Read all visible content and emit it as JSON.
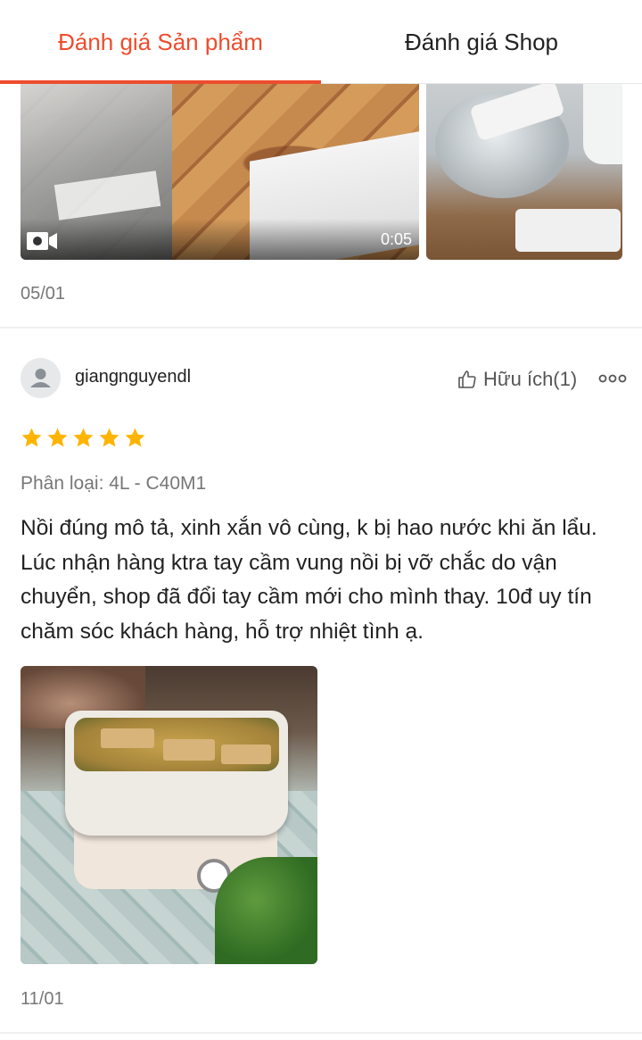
{
  "tabs": {
    "product_reviews": "Đánh giá Sản phẩm",
    "shop_reviews": "Đánh giá Shop"
  },
  "previous_review": {
    "video_duration": "0:05",
    "date": "05/01"
  },
  "review": {
    "username": "giangnguyendl",
    "helpful_label": "Hữu ích(1)",
    "rating": 5,
    "variant": "Phân loại: 4L - C40M1",
    "text": "Nồi đúng mô tả, xinh xắn vô cùng, k bị hao nước khi ăn lẩu. Lúc nhận hàng ktra tay cầm vung nồi bị vỡ chắc do vận chuyển, shop đã đổi tay cầm mới cho mình thay. 10đ uy tín chăm sóc khách hàng, hỗ trợ nhiệt tình ạ.",
    "date": "11/01"
  },
  "colors": {
    "accent": "#ee4d2d",
    "star": "#ffb400",
    "muted_text": "#777777"
  },
  "icons": [
    "video-camera-icon",
    "user-avatar-icon",
    "thumbs-up-icon",
    "more-options-icon",
    "star-icon"
  ]
}
